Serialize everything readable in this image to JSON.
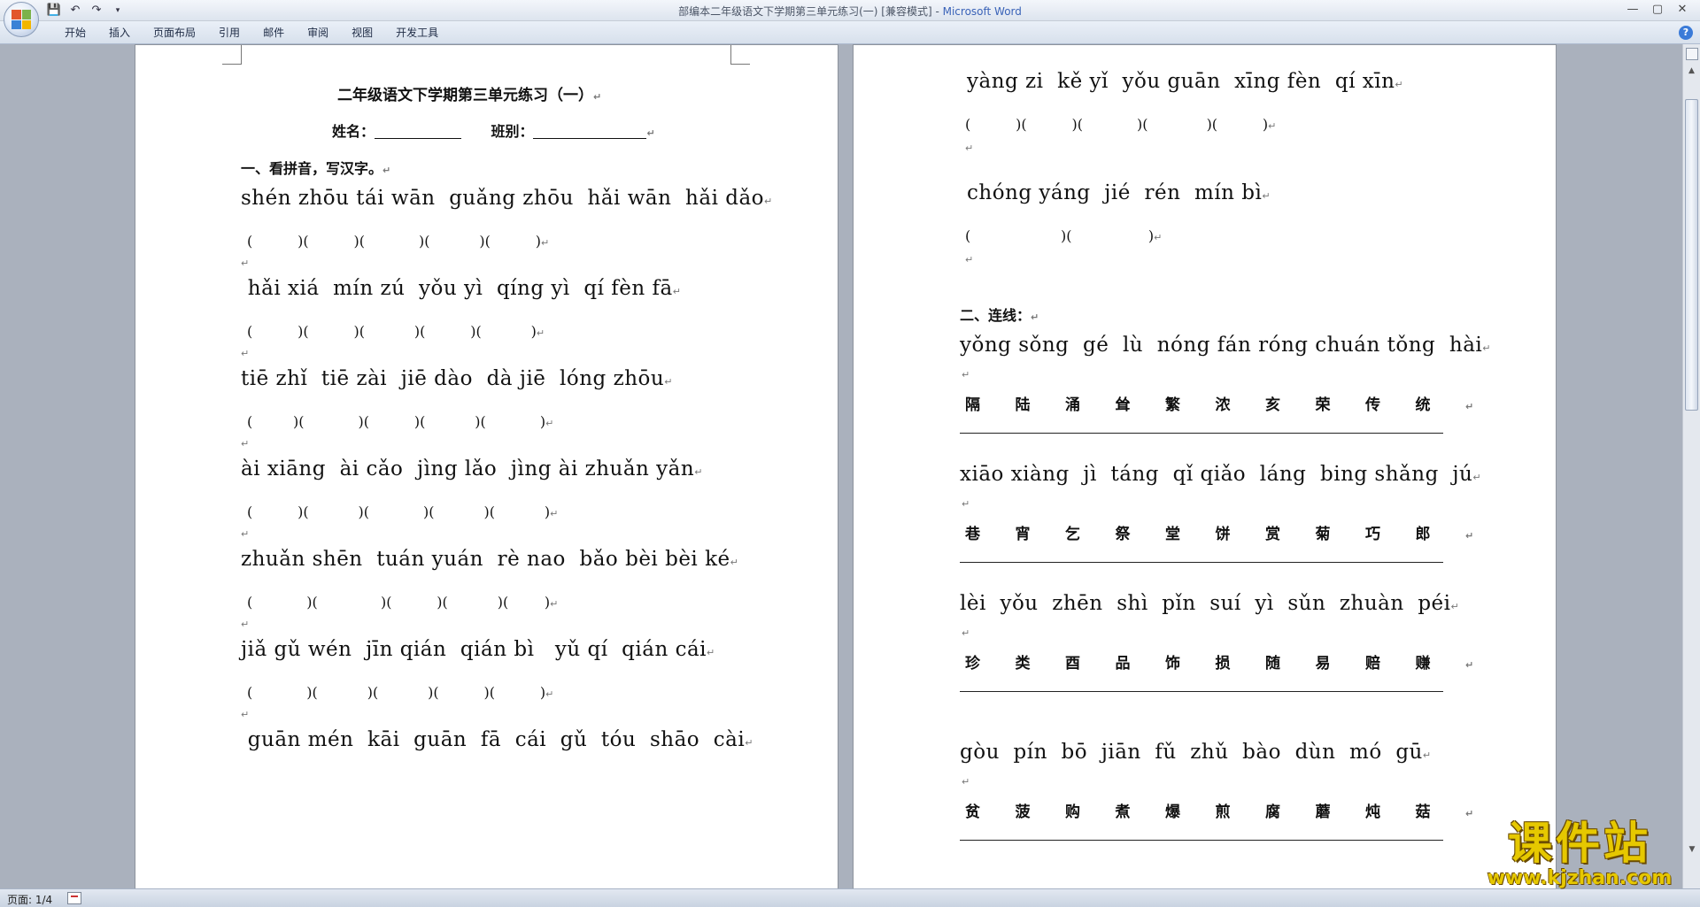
{
  "window": {
    "title": "部编本二年级语文下学期第三单元练习(一) [兼容模式] - ",
    "app_name": "Microsoft Word"
  },
  "qat": {
    "save": "💾",
    "undo": "↶",
    "redo": "↷",
    "more": "▾"
  },
  "window_controls": {
    "minimize": "—",
    "maximize": "▢",
    "close": "✕"
  },
  "tabs": [
    "开始",
    "插入",
    "页面布局",
    "引用",
    "邮件",
    "审阅",
    "视图",
    "开发工具"
  ],
  "help": "?",
  "status": {
    "page": "页面: 1/4"
  },
  "watermark": {
    "big": "课件站",
    "small": "www.kjzhan.com"
  },
  "left_page": {
    "title": "二年级语文下学期第三单元练习（一）",
    "name_label": "姓名：",
    "class_label": "班别：",
    "section1": "一、看拼音，写汉字。",
    "rows": [
      {
        "pinyin": "shén zhōu tái wān  guǎng zhōu  hǎi wān  hǎi dǎo",
        "paren": "(          )(          )(            )(           )(          )"
      },
      {
        "pinyin": " hǎi xiá  mín zú  yǒu yì  qíng yì  qí fèn fā",
        "paren": "(          )(          )(           )(          )(           )"
      },
      {
        "pinyin": "tiē zhǐ  tiē zài  jiē dào  dà jiē  lóng zhōu",
        "paren": "(         )(            )(          )(           )(            )"
      },
      {
        "pinyin": "ài xiāng  ài cǎo  jìng lǎo  jìng ài zhuǎn yǎn",
        "paren": "(          )(           )(            )(           )(           )"
      },
      {
        "pinyin": "zhuǎn shēn  tuán yuán  rè nao  bǎo bèi bèi ké",
        "paren": "(            )(              )(          )(           )(        )"
      },
      {
        "pinyin": "jiǎ gǔ wén  jīn qián  qián bì   yǔ qí  qián cái",
        "paren": "(            )(           )(           )(          )(          )"
      },
      {
        "pinyin": " guān mén  kāi  guān  fā  cái  gǔ  tóu  shāo  cài",
        "paren": ""
      }
    ]
  },
  "right_page": {
    "rows_top": [
      {
        "pinyin": "yàng zi  kě yǐ  yǒu guān  xīng fèn  qí xīn",
        "paren": "(          )(          )(            )(             )(          )"
      },
      {
        "pinyin": "chóng yáng  jié  rén  mín bì",
        "paren": "(                    )(                 )"
      }
    ],
    "section2": "二、连线：",
    "groups": [
      {
        "pinyin": "yǒng sǒng  gé  lù  nóng fán róng chuán tǒng  hài",
        "chars": [
          "隔",
          "陆",
          "涌",
          "耸",
          "繁",
          "浓",
          "亥",
          "荣",
          "传",
          "统"
        ]
      },
      {
        "pinyin": "xiāo xiàng  jì  táng  qǐ qiǎo  láng  bing shǎng  jú",
        "chars": [
          "巷",
          "宵",
          "乞",
          "祭",
          "堂",
          "饼",
          "赏",
          "菊",
          "巧",
          "郎"
        ]
      },
      {
        "pinyin": "lèi  yǒu  zhēn  shì  pǐn  suí  yì  sǔn  zhuàn  péi",
        "chars": [
          "珍",
          "类",
          "酉",
          "品",
          "饰",
          "损",
          "随",
          "易",
          "赔",
          "赚"
        ]
      },
      {
        "pinyin": "gòu  pín  bō  jiān  fǔ  zhǔ  bào  dùn  mó  gū",
        "chars": [
          "贫",
          "菠",
          "购",
          "煮",
          "爆",
          "煎",
          "腐",
          "蘑",
          "炖",
          "菇"
        ]
      }
    ]
  }
}
